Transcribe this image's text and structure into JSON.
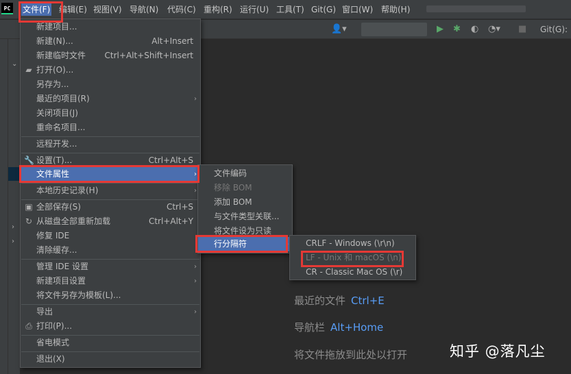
{
  "app_logo": "PC",
  "menubar": [
    "文件(F)",
    "编辑(E)",
    "视图(V)",
    "导航(N)",
    "代码(C)",
    "重构(R)",
    "运行(U)",
    "工具(T)",
    "Git(G)",
    "窗口(W)",
    "帮助(H)"
  ],
  "toolbar": {
    "git_label": "Git(G):"
  },
  "file_menu": [
    {
      "label": "新建项目..."
    },
    {
      "label": "新建(N)...",
      "shortcut": "Alt+Insert"
    },
    {
      "label": "新建临时文件",
      "shortcut": "Ctrl+Alt+Shift+Insert"
    },
    {
      "label": "打开(O)..."
    },
    {
      "label": "另存为..."
    },
    {
      "label": "最近的项目(R)"
    },
    {
      "label": "关闭项目(J)"
    },
    {
      "label": "重命名项目..."
    },
    {
      "label": "远程开发..."
    },
    {
      "label": "设置(T)...",
      "shortcut": "Ctrl+Alt+S"
    },
    {
      "label": "文件属性"
    },
    {
      "label": "本地历史记录(H)"
    },
    {
      "label": "全部保存(S)",
      "shortcut": "Ctrl+S"
    },
    {
      "label": "从磁盘全部重新加载",
      "shortcut": "Ctrl+Alt+Y"
    },
    {
      "label": "修复 IDE"
    },
    {
      "label": "清除缓存..."
    },
    {
      "label": "管理 IDE 设置"
    },
    {
      "label": "新建项目设置"
    },
    {
      "label": "将文件另存为模板(L)..."
    },
    {
      "label": "导出"
    },
    {
      "label": "打印(P)..."
    },
    {
      "label": "省电模式"
    },
    {
      "label": "退出(X)"
    }
  ],
  "file_props_menu": [
    "文件编码",
    "移除 BOM",
    "添加 BOM",
    "与文件类型关联...",
    "将文件设为只读",
    "行分隔符"
  ],
  "line_sep_menu": [
    "CRLF - Windows (\\r\\n)",
    "LF - Unix 和 macOS (\\n)",
    "CR - Classic Mac OS (\\r)"
  ],
  "welcome": {
    "recent_files": "最近的文件",
    "recent_files_key": "Ctrl+E",
    "nav_bar": "导航栏",
    "nav_bar_key": "Alt+Home",
    "drop_hint": "将文件拖放到此处以打开"
  },
  "watermark": "知乎 @落凡尘",
  "colors": {
    "selection": "#4b6eaf",
    "highlight": "#e53935",
    "shortcut_key": "#589df6"
  }
}
